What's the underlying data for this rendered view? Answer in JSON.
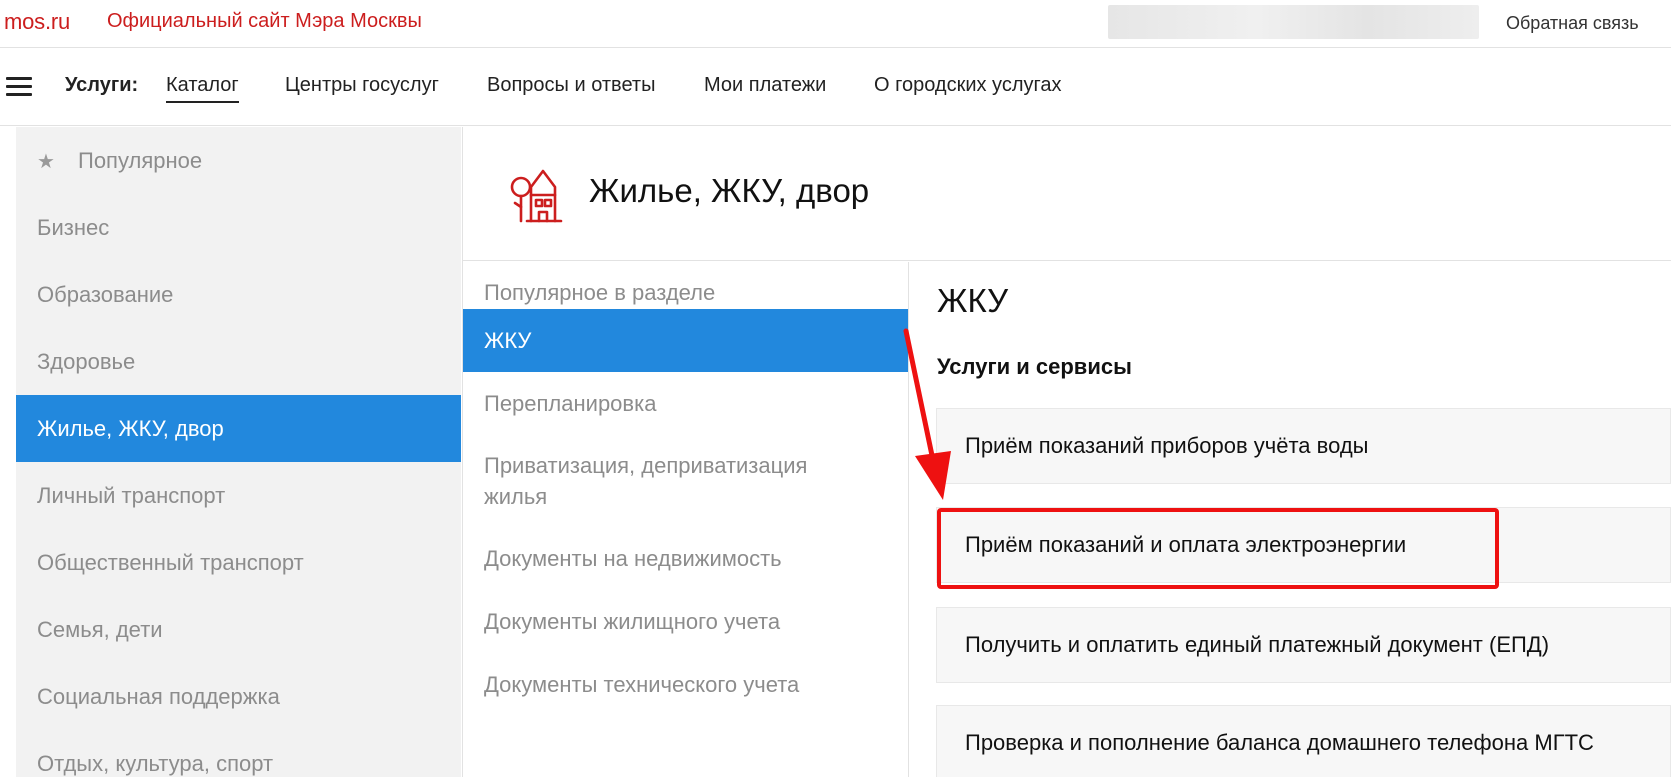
{
  "header": {
    "logo": "mos.ru",
    "site_title": "Официальный сайт Мэра Москвы",
    "feedback": "Обратная связь"
  },
  "nav": {
    "label": "Услуги:",
    "items": [
      "Каталог",
      "Центры госуслуг",
      "Вопросы и ответы",
      "Мои платежи",
      "О городских услугах"
    ],
    "active": "Каталог"
  },
  "sidebar": {
    "items": [
      {
        "label": "Популярное"
      },
      {
        "label": "Бизнес"
      },
      {
        "label": "Образование"
      },
      {
        "label": "Здоровье"
      },
      {
        "label": "Жилье, ЖКУ, двор"
      },
      {
        "label": "Личный транспорт"
      },
      {
        "label": "Общественный транспорт"
      },
      {
        "label": "Семья, дети"
      },
      {
        "label": "Социальная поддержка"
      },
      {
        "label": "Отдых, культура, спорт"
      }
    ],
    "active": "Жилье, ЖКУ, двор"
  },
  "category": {
    "title": "Жилье, ЖКУ, двор",
    "icon": "house-tree-icon"
  },
  "subcategories": {
    "items": [
      {
        "label": "Популярное в разделе"
      },
      {
        "label": "ЖКУ"
      },
      {
        "label": "Перепланировка"
      },
      {
        "label": "Приватизация, деприватизация жилья"
      },
      {
        "label": "Документы на недвижимость"
      },
      {
        "label": "Документы жилищного учета"
      },
      {
        "label": "Документы технического учета"
      }
    ],
    "active": "ЖКУ"
  },
  "content": {
    "title": "ЖКУ",
    "section_title": "Услуги и сервисы",
    "services": [
      {
        "label": "Приём показаний приборов учёта воды"
      },
      {
        "label": "Приём показаний и оплата электроэнергии"
      },
      {
        "label": "Получить и оплатить единый платежный документ (ЕПД)"
      },
      {
        "label": "Проверка и пополнение баланса домашнего телефона МГТС"
      }
    ]
  },
  "colors": {
    "brand_red": "#cc1e1e",
    "active_blue": "#2288dd",
    "annotation_red": "#ee1111"
  }
}
